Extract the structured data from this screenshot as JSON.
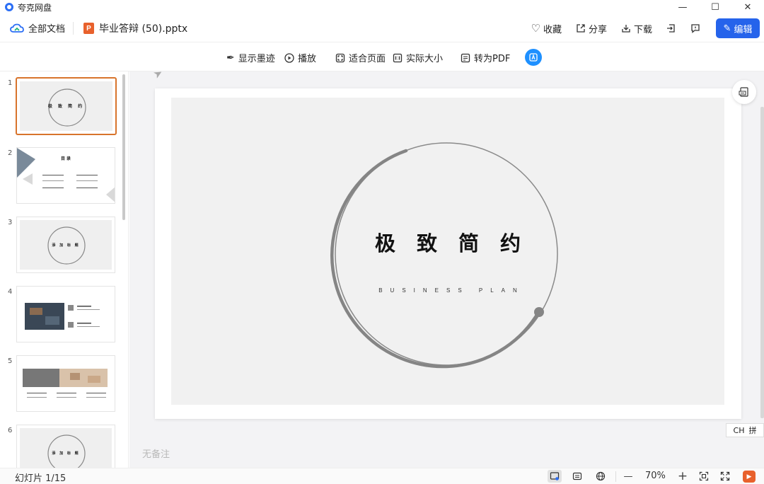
{
  "window": {
    "title": "夸克网盘",
    "min": "—",
    "max": "☐",
    "close": "✕"
  },
  "header": {
    "root_label": "全部文档",
    "file_name": "毕业答辩 (50).pptx",
    "file_badge": "P",
    "actions": {
      "favorite": "收藏",
      "share": "分享",
      "download": "下载",
      "edit": "编辑"
    }
  },
  "toolbar": {
    "show_ink": "显示墨迹",
    "play": "播放",
    "fit_page": "适合页面",
    "actual_size": "实际大小",
    "to_pdf": "转为PDF"
  },
  "thumbnails": [
    {
      "num": "1",
      "title": "极 致 简 约",
      "active": true
    },
    {
      "num": "2",
      "title": "目 录"
    },
    {
      "num": "3",
      "title": "添 加 标 题"
    },
    {
      "num": "4"
    },
    {
      "num": "5"
    },
    {
      "num": "6",
      "title": "添 加 标 题"
    }
  ],
  "slide": {
    "title": "极致简约",
    "subtitle": "BUSINESS PLAN"
  },
  "notes_placeholder": "无备注",
  "ime": {
    "mode": "CH",
    "pinyin": "拼"
  },
  "status": {
    "counter": "幻灯片 1/15",
    "zoom": "70%"
  },
  "colors": {
    "accent": "#2563eb",
    "ppt": "#e8612c",
    "active_thumb": "#d8742c"
  }
}
